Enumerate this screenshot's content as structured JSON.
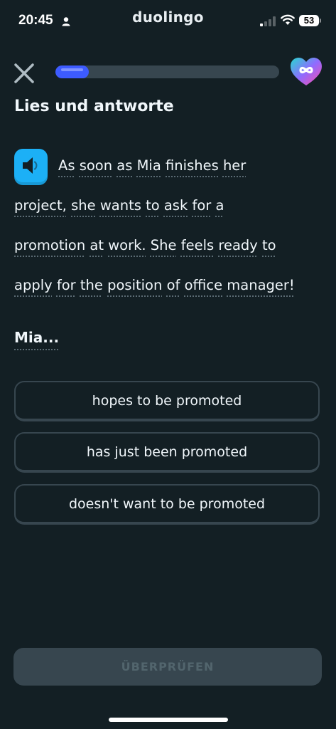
{
  "status_bar": {
    "time": "20:45",
    "battery": "53",
    "icons": [
      "person-icon",
      "signal-icon",
      "wifi-icon",
      "battery-icon"
    ]
  },
  "app": {
    "title": "duolingo"
  },
  "header": {
    "close_icon": "close-icon",
    "progress": 0.15,
    "progress_color": "#3d5bff",
    "hearts_icon": "infinity-heart-icon"
  },
  "exercise": {
    "heading": "Lies und antworte",
    "speaker_icon": "speaker-icon",
    "passage_lines": [
      [
        "As",
        "soon",
        "as",
        "Mia",
        "finishes",
        "her"
      ],
      [
        "project,",
        "she",
        "wants",
        "to",
        "ask",
        "for",
        "a"
      ],
      [
        "promotion",
        "at",
        "work.",
        "She",
        "feels",
        "ready",
        "to"
      ],
      [
        "apply",
        "for",
        "the",
        "position",
        "of",
        "office",
        "manager!"
      ]
    ],
    "question": "Mia..."
  },
  "options": [
    {
      "label": "hopes to be promoted"
    },
    {
      "label": "has just been promoted"
    },
    {
      "label": "doesn't want to be promoted"
    }
  ],
  "footer": {
    "check_label": "ÜBERPRÜFEN"
  },
  "colors": {
    "background": "#131f24",
    "border": "#37464f",
    "speaker": "#1cb0f6",
    "text": "#f1f7fb"
  }
}
